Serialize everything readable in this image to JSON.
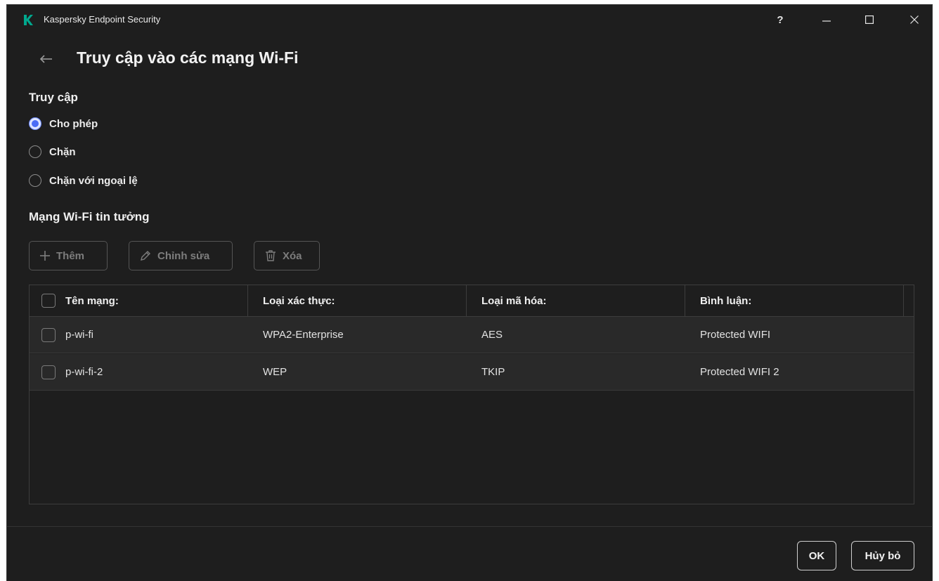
{
  "window": {
    "title": "Kaspersky Endpoint Security",
    "help_label": "?",
    "brand_color": "#00a88e"
  },
  "page": {
    "title": "Truy cập vào các mạng Wi-Fi"
  },
  "access": {
    "heading": "Truy cập",
    "options": [
      {
        "label": "Cho phép",
        "selected": true
      },
      {
        "label": "Chặn",
        "selected": false
      },
      {
        "label": "Chặn với ngoại lệ",
        "selected": false
      }
    ]
  },
  "trusted": {
    "heading": "Mạng Wi-Fi tin tưởng",
    "add_label": "Thêm",
    "edit_label": "Chỉnh sửa",
    "delete_label": "Xóa"
  },
  "table": {
    "columns": [
      "Tên mạng:",
      "Loại xác thực:",
      "Loại mã hóa:",
      "Bình luận:"
    ],
    "rows": [
      [
        "p-wi-fi",
        "WPA2-Enterprise",
        "AES",
        "Protected WIFI"
      ],
      [
        "p-wi-fi-2",
        "WEP",
        "TKIP",
        "Protected WIFI 2"
      ]
    ]
  },
  "footer": {
    "ok_label": "OK",
    "cancel_label": "Hủy bỏ"
  }
}
